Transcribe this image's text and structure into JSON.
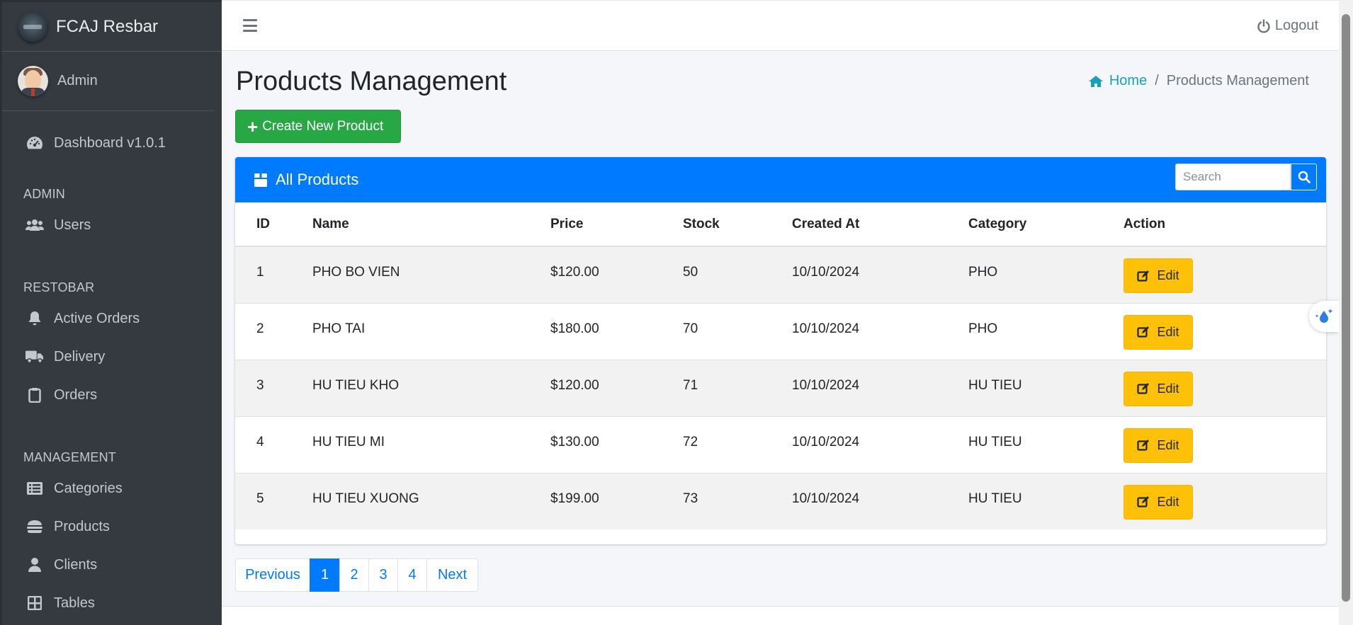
{
  "brand": {
    "name": "FCAJ Resbar"
  },
  "user": {
    "name": "Admin"
  },
  "sidebar": {
    "dashboard": {
      "label": "Dashboard v1.0.1",
      "icon": "tachometer-icon"
    },
    "sections": [
      {
        "header": "ADMIN",
        "items": [
          {
            "label": "Users",
            "icon": "users-icon"
          }
        ]
      },
      {
        "header": "RESTOBAR",
        "items": [
          {
            "label": "Active Orders",
            "icon": "bell-icon"
          },
          {
            "label": "Delivery",
            "icon": "truck-icon"
          },
          {
            "label": "Orders",
            "icon": "clipboard-icon"
          }
        ]
      },
      {
        "header": "MANAGEMENT",
        "items": [
          {
            "label": "Categories",
            "icon": "list-icon"
          },
          {
            "label": "Products",
            "icon": "burger-icon"
          },
          {
            "label": "Clients",
            "icon": "user-icon"
          },
          {
            "label": "Tables",
            "icon": "grid-icon"
          }
        ]
      }
    ]
  },
  "topbar": {
    "logout_label": "Logout"
  },
  "page": {
    "title": "Products Management",
    "breadcrumb": {
      "home": "Home",
      "current": "Products Management"
    },
    "create_button": "Create New Product"
  },
  "card": {
    "title": "All Products",
    "search_placeholder": "Search"
  },
  "table": {
    "headers": [
      "ID",
      "Name",
      "Price",
      "Stock",
      "Created At",
      "Category",
      "Action"
    ],
    "edit_label": "Edit",
    "rows": [
      {
        "id": "1",
        "name": "PHO BO VIEN",
        "price": "$120.00",
        "stock": "50",
        "created_at": "10/10/2024",
        "category": "PHO"
      },
      {
        "id": "2",
        "name": "PHO TAI",
        "price": "$180.00",
        "stock": "70",
        "created_at": "10/10/2024",
        "category": "PHO"
      },
      {
        "id": "3",
        "name": "HU TIEU KHO",
        "price": "$120.00",
        "stock": "71",
        "created_at": "10/10/2024",
        "category": "HU TIEU"
      },
      {
        "id": "4",
        "name": "HU TIEU MI",
        "price": "$130.00",
        "stock": "72",
        "created_at": "10/10/2024",
        "category": "HU TIEU"
      },
      {
        "id": "5",
        "name": "HU TIEU XUONG",
        "price": "$199.00",
        "stock": "73",
        "created_at": "10/10/2024",
        "category": "HU TIEU"
      }
    ]
  },
  "pagination": {
    "previous": "Previous",
    "pages": [
      "1",
      "2",
      "3",
      "4"
    ],
    "active": "1",
    "next": "Next"
  },
  "colors": {
    "sidebar_bg": "#343a40",
    "primary": "#007bff",
    "success": "#28a745",
    "warning": "#ffc107",
    "info": "#17a2b8"
  }
}
